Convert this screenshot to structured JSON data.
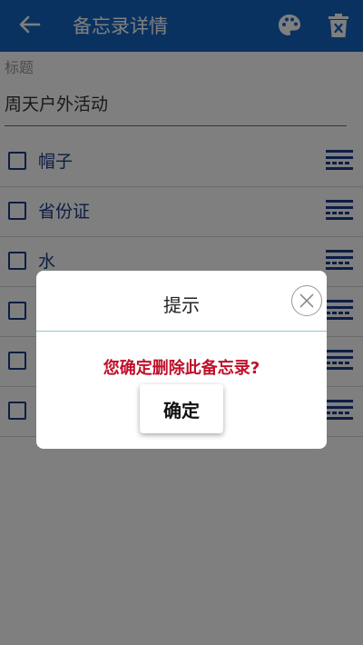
{
  "appbar": {
    "title": "备忘录详情",
    "back_icon": "arrow-left-icon",
    "palette_icon": "palette-icon",
    "delete_icon": "trash-icon",
    "color": "#1565c0"
  },
  "form": {
    "title_label": "标题",
    "title_value": "周天户外活动"
  },
  "items": [
    {
      "text": "帽子",
      "checked": false
    },
    {
      "text": "省份证",
      "checked": false
    },
    {
      "text": "水",
      "checked": false
    },
    {
      "text": "",
      "checked": false
    },
    {
      "text": "",
      "checked": false
    },
    {
      "text": "",
      "checked": false
    }
  ],
  "dialog": {
    "title": "提示",
    "message": "您确定删除此备忘录?",
    "confirm_label": "确定",
    "close_icon": "close-circle-icon",
    "message_color": "#c0102a"
  }
}
